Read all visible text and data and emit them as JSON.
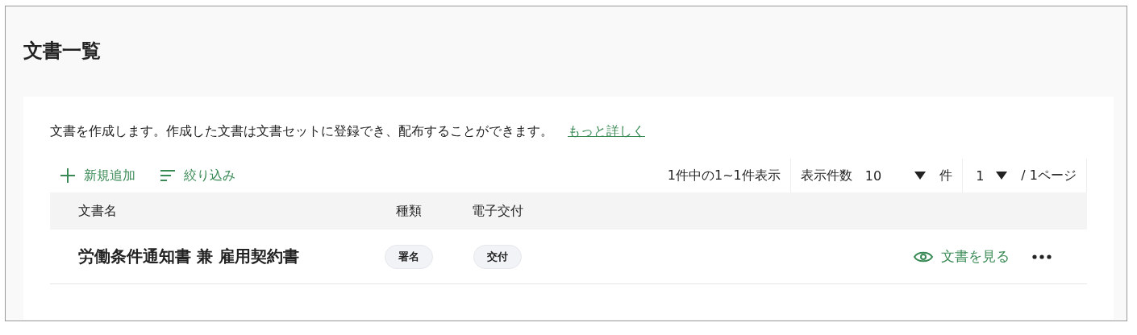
{
  "page": {
    "title": "文書一覧"
  },
  "description": {
    "text": "文書を作成します。作成した文書は文書セットに登録でき、配布することができます。",
    "link": "もっと詳しく"
  },
  "toolbar": {
    "add": "新規追加",
    "filter": "絞り込み"
  },
  "pager": {
    "summary": "1件中の1~1件表示",
    "per_page_label": "表示件数",
    "per_page": "10",
    "per_page_unit": "件",
    "page": "1",
    "page_total": "/ 1ページ"
  },
  "table": {
    "columns": [
      "文書名",
      "種類",
      "電子交付"
    ],
    "rows": [
      {
        "name": "労働条件通知書 兼 雇用契約書",
        "type": "署名",
        "delivery": "交付",
        "view": "文書を見る"
      }
    ]
  }
}
